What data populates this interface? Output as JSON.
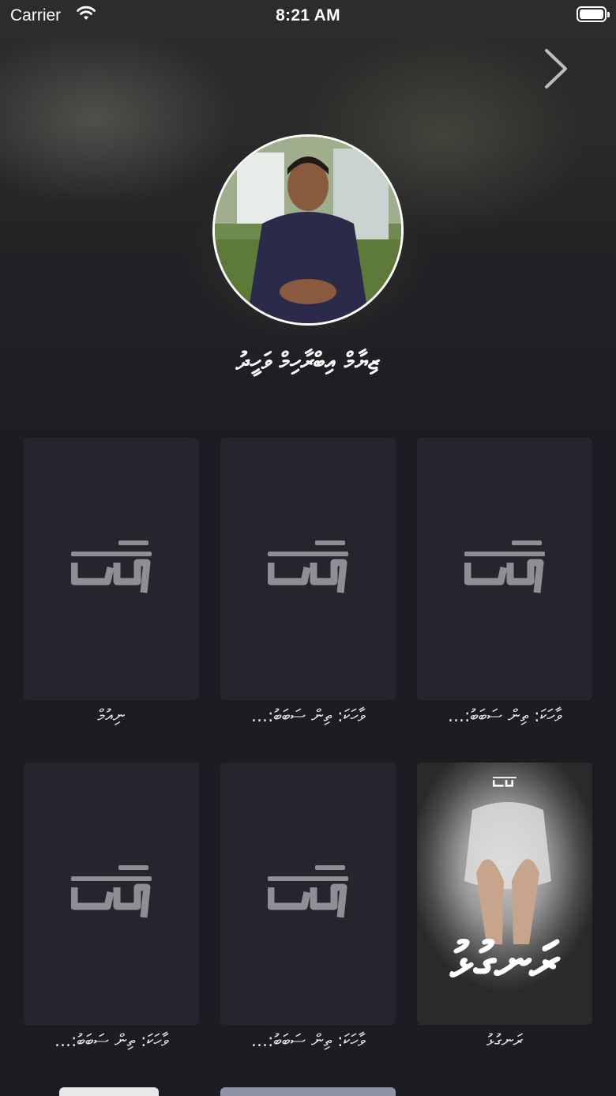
{
  "status_bar": {
    "carrier": "Carrier",
    "time": "8:21 AM"
  },
  "header": {
    "next_icon": "chevron-right-icon",
    "author_name": "ޒިޔާމް އިބްރާހިމް ވަހީދު"
  },
  "books": [
    {
      "title": "ނިއުމް",
      "cover": "placeholder-logo"
    },
    {
      "title": "ވާހަކަ: ތިން ސަބަބު:...",
      "cover": "placeholder-logo"
    },
    {
      "title": "ވާހަކަ: ތިން ސަބަބު:...",
      "cover": "placeholder-logo"
    },
    {
      "title": "ވާހަކަ: ތިން ސަބަބު:...",
      "cover": "placeholder-logo"
    },
    {
      "title": "ވާހަކަ: ތިން ސަބަބު:...",
      "cover": "placeholder-logo"
    },
    {
      "title": "ރަނގުޅު",
      "cover": "image",
      "cover_text": "ރަނގުޅު"
    }
  ],
  "colors": {
    "background": "#1c1d23",
    "card": "#25262d",
    "logo": "#8e8e93"
  }
}
